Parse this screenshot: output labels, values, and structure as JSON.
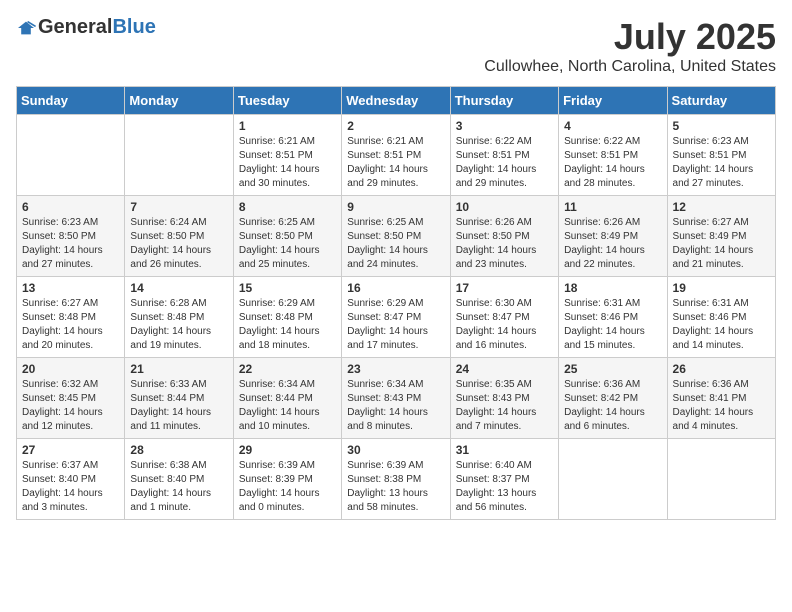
{
  "header": {
    "logo_general": "General",
    "logo_blue": "Blue",
    "month_year": "July 2025",
    "location": "Cullowhee, North Carolina, United States"
  },
  "weekdays": [
    "Sunday",
    "Monday",
    "Tuesday",
    "Wednesday",
    "Thursday",
    "Friday",
    "Saturday"
  ],
  "weeks": [
    [
      {
        "day": "",
        "info": ""
      },
      {
        "day": "",
        "info": ""
      },
      {
        "day": "1",
        "info": "Sunrise: 6:21 AM\nSunset: 8:51 PM\nDaylight: 14 hours\nand 30 minutes."
      },
      {
        "day": "2",
        "info": "Sunrise: 6:21 AM\nSunset: 8:51 PM\nDaylight: 14 hours\nand 29 minutes."
      },
      {
        "day": "3",
        "info": "Sunrise: 6:22 AM\nSunset: 8:51 PM\nDaylight: 14 hours\nand 29 minutes."
      },
      {
        "day": "4",
        "info": "Sunrise: 6:22 AM\nSunset: 8:51 PM\nDaylight: 14 hours\nand 28 minutes."
      },
      {
        "day": "5",
        "info": "Sunrise: 6:23 AM\nSunset: 8:51 PM\nDaylight: 14 hours\nand 27 minutes."
      }
    ],
    [
      {
        "day": "6",
        "info": "Sunrise: 6:23 AM\nSunset: 8:50 PM\nDaylight: 14 hours\nand 27 minutes."
      },
      {
        "day": "7",
        "info": "Sunrise: 6:24 AM\nSunset: 8:50 PM\nDaylight: 14 hours\nand 26 minutes."
      },
      {
        "day": "8",
        "info": "Sunrise: 6:25 AM\nSunset: 8:50 PM\nDaylight: 14 hours\nand 25 minutes."
      },
      {
        "day": "9",
        "info": "Sunrise: 6:25 AM\nSunset: 8:50 PM\nDaylight: 14 hours\nand 24 minutes."
      },
      {
        "day": "10",
        "info": "Sunrise: 6:26 AM\nSunset: 8:50 PM\nDaylight: 14 hours\nand 23 minutes."
      },
      {
        "day": "11",
        "info": "Sunrise: 6:26 AM\nSunset: 8:49 PM\nDaylight: 14 hours\nand 22 minutes."
      },
      {
        "day": "12",
        "info": "Sunrise: 6:27 AM\nSunset: 8:49 PM\nDaylight: 14 hours\nand 21 minutes."
      }
    ],
    [
      {
        "day": "13",
        "info": "Sunrise: 6:27 AM\nSunset: 8:48 PM\nDaylight: 14 hours\nand 20 minutes."
      },
      {
        "day": "14",
        "info": "Sunrise: 6:28 AM\nSunset: 8:48 PM\nDaylight: 14 hours\nand 19 minutes."
      },
      {
        "day": "15",
        "info": "Sunrise: 6:29 AM\nSunset: 8:48 PM\nDaylight: 14 hours\nand 18 minutes."
      },
      {
        "day": "16",
        "info": "Sunrise: 6:29 AM\nSunset: 8:47 PM\nDaylight: 14 hours\nand 17 minutes."
      },
      {
        "day": "17",
        "info": "Sunrise: 6:30 AM\nSunset: 8:47 PM\nDaylight: 14 hours\nand 16 minutes."
      },
      {
        "day": "18",
        "info": "Sunrise: 6:31 AM\nSunset: 8:46 PM\nDaylight: 14 hours\nand 15 minutes."
      },
      {
        "day": "19",
        "info": "Sunrise: 6:31 AM\nSunset: 8:46 PM\nDaylight: 14 hours\nand 14 minutes."
      }
    ],
    [
      {
        "day": "20",
        "info": "Sunrise: 6:32 AM\nSunset: 8:45 PM\nDaylight: 14 hours\nand 12 minutes."
      },
      {
        "day": "21",
        "info": "Sunrise: 6:33 AM\nSunset: 8:44 PM\nDaylight: 14 hours\nand 11 minutes."
      },
      {
        "day": "22",
        "info": "Sunrise: 6:34 AM\nSunset: 8:44 PM\nDaylight: 14 hours\nand 10 minutes."
      },
      {
        "day": "23",
        "info": "Sunrise: 6:34 AM\nSunset: 8:43 PM\nDaylight: 14 hours\nand 8 minutes."
      },
      {
        "day": "24",
        "info": "Sunrise: 6:35 AM\nSunset: 8:43 PM\nDaylight: 14 hours\nand 7 minutes."
      },
      {
        "day": "25",
        "info": "Sunrise: 6:36 AM\nSunset: 8:42 PM\nDaylight: 14 hours\nand 6 minutes."
      },
      {
        "day": "26",
        "info": "Sunrise: 6:36 AM\nSunset: 8:41 PM\nDaylight: 14 hours\nand 4 minutes."
      }
    ],
    [
      {
        "day": "27",
        "info": "Sunrise: 6:37 AM\nSunset: 8:40 PM\nDaylight: 14 hours\nand 3 minutes."
      },
      {
        "day": "28",
        "info": "Sunrise: 6:38 AM\nSunset: 8:40 PM\nDaylight: 14 hours\nand 1 minute."
      },
      {
        "day": "29",
        "info": "Sunrise: 6:39 AM\nSunset: 8:39 PM\nDaylight: 14 hours\nand 0 minutes."
      },
      {
        "day": "30",
        "info": "Sunrise: 6:39 AM\nSunset: 8:38 PM\nDaylight: 13 hours\nand 58 minutes."
      },
      {
        "day": "31",
        "info": "Sunrise: 6:40 AM\nSunset: 8:37 PM\nDaylight: 13 hours\nand 56 minutes."
      },
      {
        "day": "",
        "info": ""
      },
      {
        "day": "",
        "info": ""
      }
    ]
  ]
}
